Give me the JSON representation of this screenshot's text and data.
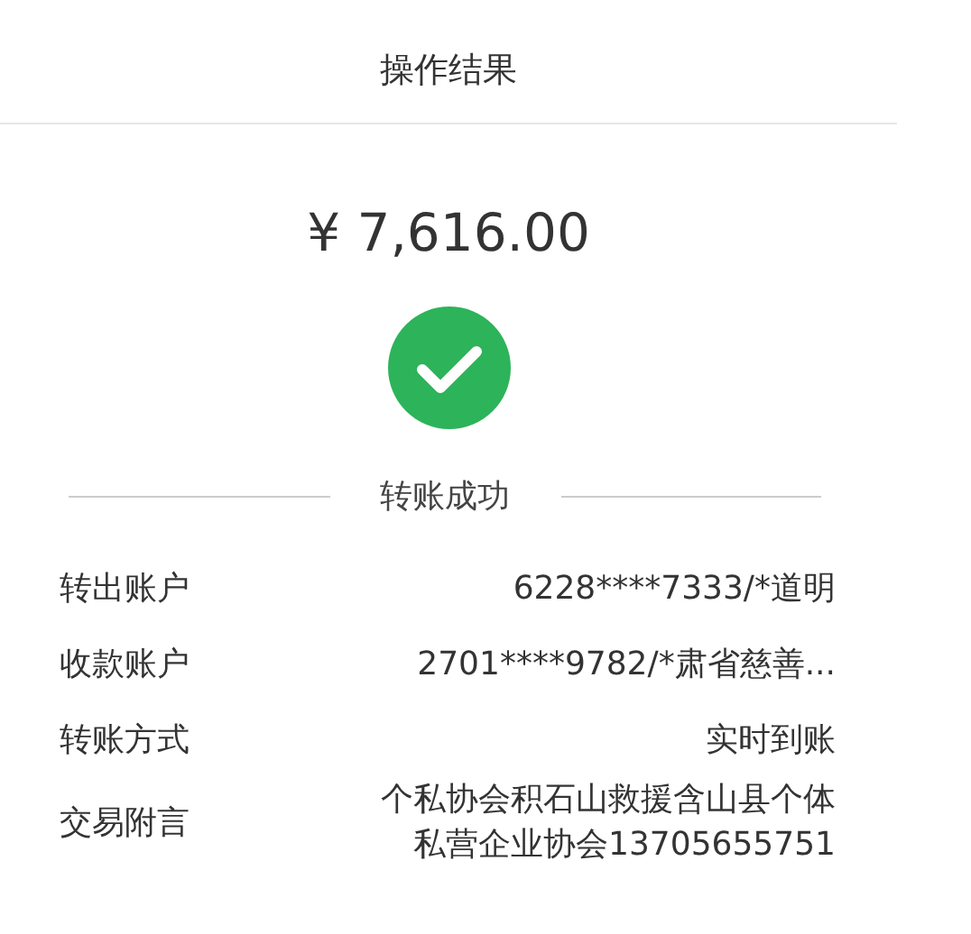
{
  "header": {
    "title": "操作结果"
  },
  "amount": "¥ 7,616.00",
  "status": {
    "kind": "success",
    "label": "转账成功"
  },
  "details": [
    {
      "label": "转出账户",
      "lines": [
        "6228****7333/*道明"
      ]
    },
    {
      "label": "收款账户",
      "lines": [
        "2701****9782/*肃省慈善..."
      ]
    },
    {
      "label": "转账方式",
      "lines": [
        "实时到账"
      ]
    },
    {
      "label": "交易附言",
      "lines": [
        "个私协会积石山救援含山县个体",
        "私营企业协会13705655751"
      ]
    }
  ]
}
